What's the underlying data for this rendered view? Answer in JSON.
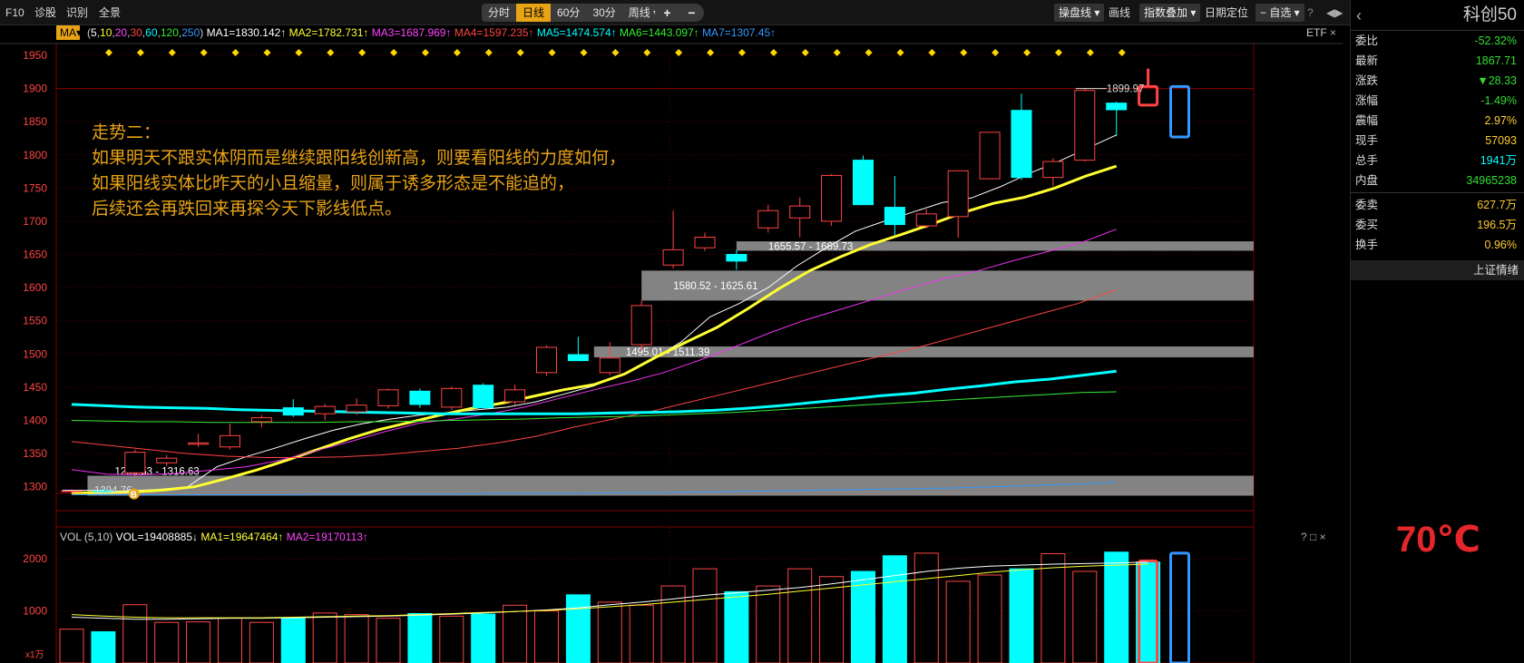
{
  "toolbar": {
    "f10": "F10",
    "diagnose": "诊股",
    "identify": "识别",
    "fullscreen": "全景",
    "periods": [
      "分时",
      "日线",
      "60分",
      "30分",
      "周线 ▾"
    ],
    "active_period": "日线",
    "plus": "+",
    "minus": "−",
    "right": [
      "操盘线 ▾",
      "画线",
      "指数叠加 ▾",
      "日期定位",
      "− 自选 ▾",
      "?"
    ],
    "far_right": "◀▶"
  },
  "indicator": {
    "ma_button": "MA▾",
    "params_open": "(",
    "params": [
      "5",
      "10",
      "20",
      "30",
      "60",
      "120",
      "250"
    ],
    "params_close": ")",
    "ma_values": [
      {
        "label": "MA1=1830.142↑",
        "color": "#ffffff"
      },
      {
        "label": "MA2=1782.731↑",
        "color": "#ffff33"
      },
      {
        "label": "MA3=1687.969↑",
        "color": "#ff44ff"
      },
      {
        "label": "MA4=1597.235↑",
        "color": "#ff4444"
      },
      {
        "label": "MA5=1474.574↑",
        "color": "#00ffff"
      },
      {
        "label": "MA6=1443.097↑",
        "color": "#33ee33"
      },
      {
        "label": "MA7=1307.45↑",
        "color": "#3399ff"
      }
    ],
    "etf": "ETF",
    "close_label": "×"
  },
  "annotation": {
    "title": "走势二：",
    "lines": [
      "如果明天不跟实体阴而是继续跟阳线创新高，则要看阳线的力度如何，",
      "如果阳线实体比昨天的小且缩量，则属于诱多形态是不能追的，",
      "后续还会再跌回来再探今天下影线低点。"
    ],
    "color": "#e8a317"
  },
  "volume_indicator": {
    "label": "VOL",
    "params": "(5,10)",
    "vol": "VOL=19408885↓",
    "ma1": "MA1=19647464↑",
    "ma2": "MA2=19170113↑",
    "controls": "? □ ×",
    "unit": "x1万"
  },
  "colors": {
    "up": "#ff4444",
    "down": "#00ffff",
    "grid": "#8b0000",
    "axis_text": "#ff4444",
    "box": "#9a9a9a"
  },
  "chart_data": {
    "type": "candlestick",
    "ylim": [
      1290,
      1965
    ],
    "y_ticks": [
      1300,
      1350,
      1400,
      1450,
      1500,
      1550,
      1600,
      1650,
      1700,
      1750,
      1800,
      1850,
      1900,
      1950
    ],
    "candles": [
      {
        "o": 1293,
        "h": 1296,
        "l": 1288,
        "c": 1294
      },
      {
        "o": 1294,
        "h": 1298,
        "l": 1289,
        "c": 1293
      },
      {
        "o": 1321,
        "h": 1356,
        "l": 1316,
        "c": 1352
      },
      {
        "o": 1336,
        "h": 1348,
        "l": 1331,
        "c": 1343
      },
      {
        "o": 1364,
        "h": 1380,
        "l": 1360,
        "c": 1366
      },
      {
        "o": 1360,
        "h": 1395,
        "l": 1356,
        "c": 1377
      },
      {
        "o": 1398,
        "h": 1408,
        "l": 1390,
        "c": 1404
      },
      {
        "o": 1419,
        "h": 1432,
        "l": 1405,
        "c": 1408
      },
      {
        "o": 1410,
        "h": 1425,
        "l": 1400,
        "c": 1421
      },
      {
        "o": 1413,
        "h": 1433,
        "l": 1408,
        "c": 1423
      },
      {
        "o": 1422,
        "h": 1448,
        "l": 1418,
        "c": 1446
      },
      {
        "o": 1444,
        "h": 1448,
        "l": 1419,
        "c": 1424
      },
      {
        "o": 1420,
        "h": 1451,
        "l": 1416,
        "c": 1448
      },
      {
        "o": 1453,
        "h": 1456,
        "l": 1418,
        "c": 1419
      },
      {
        "o": 1428,
        "h": 1454,
        "l": 1423,
        "c": 1446
      },
      {
        "o": 1472,
        "h": 1513,
        "l": 1467,
        "c": 1510
      },
      {
        "o": 1499,
        "h": 1526,
        "l": 1492,
        "c": 1490
      },
      {
        "o": 1472,
        "h": 1518,
        "l": 1468,
        "c": 1494
      },
      {
        "o": 1514,
        "h": 1581,
        "l": 1506,
        "c": 1573
      },
      {
        "o": 1634,
        "h": 1716,
        "l": 1629,
        "c": 1657
      },
      {
        "o": 1660,
        "h": 1683,
        "l": 1655,
        "c": 1676
      },
      {
        "o": 1650,
        "h": 1657,
        "l": 1627,
        "c": 1640
      },
      {
        "o": 1690,
        "h": 1725,
        "l": 1683,
        "c": 1716
      },
      {
        "o": 1705,
        "h": 1736,
        "l": 1676,
        "c": 1723
      },
      {
        "o": 1700,
        "h": 1771,
        "l": 1693,
        "c": 1769
      },
      {
        "o": 1792,
        "h": 1799,
        "l": 1725,
        "c": 1725
      },
      {
        "o": 1721,
        "h": 1768,
        "l": 1679,
        "c": 1695
      },
      {
        "o": 1693,
        "h": 1718,
        "l": 1689,
        "c": 1711
      },
      {
        "o": 1707,
        "h": 1776,
        "l": 1675,
        "c": 1776
      },
      {
        "o": 1764,
        "h": 1834,
        "l": 1764,
        "c": 1834
      },
      {
        "o": 1867,
        "h": 1892,
        "l": 1762,
        "c": 1766
      },
      {
        "o": 1766,
        "h": 1795,
        "l": 1753,
        "c": 1790
      },
      {
        "o": 1792,
        "h": 1900,
        "l": 1790,
        "c": 1897
      },
      {
        "o": 1878,
        "h": 1880,
        "l": 1828,
        "c": 1868
      }
    ],
    "hypothetical": [
      {
        "color": "#ff4444",
        "top": 1903,
        "bottom": 1875,
        "wick": 1930
      },
      {
        "color": "#3399ff",
        "top": 1903,
        "bottom": 1827,
        "wick": 1903
      }
    ],
    "ma_lines": [
      {
        "name": "MA1",
        "color": "#ffffff",
        "width": 1,
        "values": [
          1291,
          1292,
          1294,
          1296,
          1300,
          1330,
          1345,
          1358,
          1372,
          1385,
          1395,
          1402,
          1408,
          1412,
          1416,
          1420,
          1428,
          1440,
          1452,
          1470,
          1492,
          1518,
          1556,
          1576,
          1600,
          1633,
          1660,
          1685,
          1700,
          1714,
          1728,
          1735,
          1752,
          1772,
          1790,
          1810,
          1830
        ]
      },
      {
        "name": "MA2",
        "color": "#ffff33",
        "width": 3,
        "values": [
          1291,
          1291,
          1292,
          1295,
          1300,
          1312,
          1325,
          1340,
          1356,
          1372,
          1386,
          1397,
          1408,
          1418,
          1426,
          1436,
          1446,
          1454,
          1470,
          1495,
          1518,
          1540,
          1568,
          1598,
          1625,
          1646,
          1665,
          1680,
          1696,
          1713,
          1727,
          1736,
          1750,
          1768,
          1783
        ]
      },
      {
        "name": "MA3",
        "color": "#ee33ee",
        "width": 1,
        "values": [
          1326,
          1319,
          1318,
          1320,
          1325,
          1330,
          1340,
          1354,
          1368,
          1383,
          1396,
          1402,
          1410,
          1420,
          1433,
          1446,
          1458,
          1472,
          1490,
          1510,
          1531,
          1550,
          1566,
          1582,
          1598,
          1613,
          1625,
          1640,
          1654,
          1668,
          1688
        ]
      },
      {
        "name": "MA4",
        "color": "#ff4444",
        "width": 1,
        "values": [
          1368,
          1362,
          1356,
          1350,
          1346,
          1344,
          1344,
          1345,
          1348,
          1353,
          1358,
          1366,
          1376,
          1390,
          1402,
          1414,
          1428,
          1442,
          1456,
          1470,
          1484,
          1498,
          1512,
          1528,
          1544,
          1560,
          1576,
          1597
        ]
      },
      {
        "name": "MA5",
        "color": "#00ffff",
        "width": 3,
        "values": [
          1424,
          1422,
          1420,
          1419,
          1418,
          1416,
          1415,
          1414,
          1413,
          1412,
          1411,
          1410,
          1410,
          1410,
          1410,
          1410,
          1411,
          1412,
          1413,
          1415,
          1418,
          1422,
          1427,
          1432,
          1437,
          1441,
          1447,
          1452,
          1458,
          1462,
          1468,
          1474
        ]
      },
      {
        "name": "MA6",
        "color": "#33ee33",
        "width": 1,
        "values": [
          1400,
          1399,
          1398,
          1398,
          1397,
          1397,
          1397,
          1397,
          1398,
          1398,
          1399,
          1400,
          1401,
          1402,
          1404,
          1405,
          1406,
          1408,
          1410,
          1412,
          1415,
          1418,
          1421,
          1424,
          1427,
          1430,
          1433,
          1436,
          1439,
          1442,
          1443
        ]
      },
      {
        "name": "MA7",
        "color": "#3399ff",
        "width": 1,
        "values": [
          1288,
          1288,
          1288,
          1288,
          1288,
          1288,
          1289,
          1289,
          1289,
          1289,
          1290,
          1290,
          1290,
          1291,
          1291,
          1292,
          1293,
          1294,
          1295,
          1296,
          1297,
          1298,
          1300,
          1302,
          1304,
          1307
        ]
      }
    ],
    "support_boxes": [
      {
        "low": 1286.53,
        "high": 1316.63,
        "label": "1286.53 - 1316.63",
        "start": 1
      },
      {
        "low": 1495.01,
        "high": 1511.39,
        "label": "1495.01 - 1511.39",
        "start": 17
      },
      {
        "low": 1580.52,
        "high": 1625.61,
        "label": "1580.52 - 1625.61",
        "start": 18.5
      },
      {
        "low": 1655.57,
        "high": 1669.73,
        "label": "1655.57 - 1669.73",
        "start": 21.5
      }
    ],
    "price_labels": [
      {
        "value": 1899.97,
        "label": "1899.97"
      },
      {
        "value": 1294.76,
        "label": "1294.76"
      }
    ],
    "b_marker": {
      "label": "B",
      "index": 2,
      "value": 1300
    },
    "volume": {
      "ylim": [
        0,
        2300
      ],
      "y_ticks": [
        1000,
        2000
      ],
      "values": [
        650,
        600,
        1120,
        780,
        790,
        860,
        780,
        860,
        960,
        930,
        860,
        950,
        900,
        940,
        1110,
        1000,
        1310,
        1170,
        1110,
        1480,
        1810,
        1370,
        1480,
        1810,
        1660,
        1760,
        2060,
        2110,
        1570,
        1690,
        1810,
        2100,
        1760,
        2130,
        1940
      ],
      "ma": [
        880,
        860,
        840,
        840,
        850,
        860,
        860,
        870,
        880,
        890,
        900,
        920,
        940,
        960,
        990,
        1020,
        1060,
        1120,
        1170,
        1230,
        1300,
        1350,
        1400,
        1450,
        1520,
        1600,
        1680,
        1760,
        1820,
        1860,
        1880,
        1900,
        1910,
        1920,
        1940
      ],
      "ma2": [
        930,
        900,
        880,
        870,
        870,
        870,
        870,
        880,
        890,
        900,
        910,
        930,
        950,
        970,
        990,
        1010,
        1040,
        1080,
        1120,
        1170,
        1220,
        1270,
        1320,
        1380,
        1440,
        1500,
        1560,
        1620,
        1680,
        1740,
        1790,
        1830,
        1860,
        1880,
        1900
      ],
      "hypothetical": [
        {
          "color": "#ff4444",
          "value": 1960
        },
        {
          "color": "#3399ff",
          "value": 2110
        }
      ]
    }
  },
  "side": {
    "back": "‹",
    "name": "科创50",
    "rows": [
      {
        "label": "委比",
        "value": "-52.32%",
        "color": "#33dd33"
      },
      {
        "label": "最新",
        "value": "1867.71",
        "color": "#33dd33"
      },
      {
        "label": "涨跌",
        "value": "▼28.33",
        "color": "#33dd33"
      },
      {
        "label": "涨幅",
        "value": "-1.49%",
        "color": "#33dd33"
      },
      {
        "label": "震幅",
        "value": "2.97%",
        "color": "#ffcc33"
      },
      {
        "label": "现手",
        "value": "57093",
        "color": "#ffcc33"
      },
      {
        "label": "总手",
        "value": "1941万",
        "color": "#00ffff"
      },
      {
        "label": "内盘",
        "value": "34965238",
        "color": "#33dd33"
      }
    ],
    "rows2": [
      {
        "label": "委卖",
        "value": "627.7万",
        "color": "#ffcc33"
      },
      {
        "label": "委买",
        "value": "196.5万",
        "color": "#ffcc33"
      },
      {
        "label": "换手",
        "value": "0.96%",
        "color": "#ffcc33"
      }
    ],
    "link": "上证情绪",
    "temperature": "70℃"
  }
}
